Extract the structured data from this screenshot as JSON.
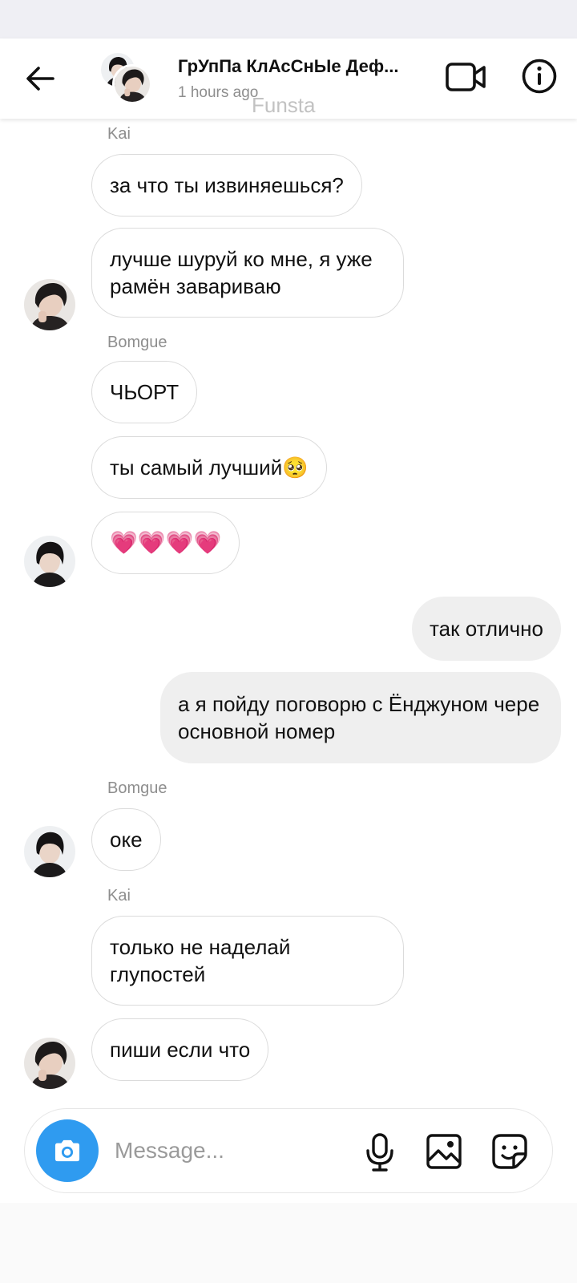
{
  "header": {
    "title": "ГрУпПа КлАсСнЫе Деф...",
    "subtitle": "1 hours ago",
    "watermark": "Funsta"
  },
  "icons": {
    "back": "arrow-left-icon",
    "video": "video-camera-icon",
    "info": "info-circle-icon",
    "camera": "camera-icon",
    "mic": "microphone-icon",
    "gallery": "image-icon",
    "sticker": "sticker-icon"
  },
  "colors": {
    "accent": "#2f9bf0",
    "outgoing_bubble": "#efefef",
    "incoming_border": "#dbdbdb",
    "secondary_text": "#8e8e8e"
  },
  "messages": {
    "sender_kai_1": "Kai",
    "m1": "за что ты извиняешься?",
    "m2": "лучше шуруй ко мне, я уже рамён завариваю",
    "sender_bomgue_1": "Bomgue",
    "m3": "ЧЬОРТ",
    "m4": "ты самый лучший🥺",
    "m5": "💗💗💗💗",
    "m6": "так отлично",
    "m7": "а я пойду поговорю с Ёнджуном чере основной номер",
    "sender_bomgue_2": "Bomgue",
    "m8": "оке",
    "sender_kai_2": "Kai",
    "m9": "только не наделай глупостей",
    "m10": "пиши если что"
  },
  "composer": {
    "placeholder": "Message..."
  }
}
